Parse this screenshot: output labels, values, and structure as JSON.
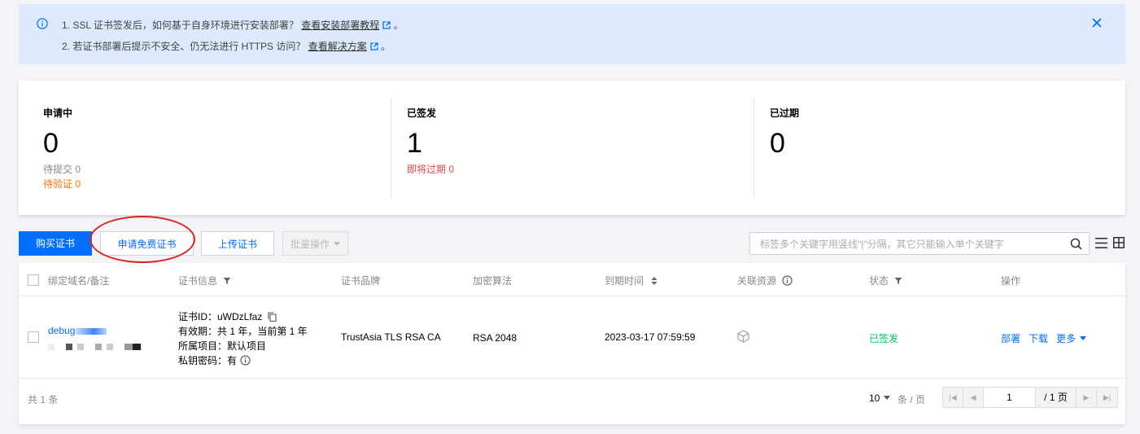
{
  "notice": {
    "line1_text": "1. SSL 证书签发后，如何基于自身环境进行安装部署？",
    "line1_link": "查看安装部署教程",
    "line1_end": "。",
    "line2_text": "2. 若证书部署后提示不安全、仍无法进行 HTTPS 访问？",
    "line2_link": "查看解决方案",
    "line2_end": "。"
  },
  "stats": [
    {
      "title": "申请中",
      "value": "0",
      "subs": [
        {
          "text": "待提交 0",
          "color": "#888888"
        },
        {
          "text": "待验证 0",
          "color": "#ff7200"
        }
      ]
    },
    {
      "title": "已签发",
      "value": "1",
      "subs": [
        {
          "text": "即将过期 0",
          "color": "#e54545"
        }
      ]
    },
    {
      "title": "已过期",
      "value": "0",
      "subs": []
    }
  ],
  "toolbar": {
    "buy_label": "购买证书",
    "apply_label": "申请免费证书",
    "upload_label": "上传证书",
    "batch_label": "批量操作",
    "search_placeholder": "标签多个关键字用竖线\"|\"分隔，其它只能输入单个关键字"
  },
  "table": {
    "headers": [
      "绑定域名/备注",
      "证书信息",
      "证书品牌",
      "加密算法",
      "到期时间",
      "关联资源",
      "状态",
      "操作"
    ],
    "rows": [
      {
        "domain": "debug",
        "cert_id": "证书ID：uWDzLfaz",
        "validity": "有效期：共 1 年，当前第 1 年",
        "project": "所属项目：默认项目",
        "private_key": "私钥密码：有",
        "brand": "TrustAsia TLS RSA CA",
        "algorithm": "RSA 2048",
        "expire": "2023-03-17 07:59:59",
        "status": "已签发",
        "ops": [
          "部署",
          "下载",
          "更多"
        ]
      }
    ],
    "footer": {
      "total": "共 1 条",
      "page_size": "10",
      "per_page": "条 / 页",
      "current_page": "1",
      "total_pages": "/ 1 页"
    }
  },
  "colors": {
    "primary": "#006eff",
    "notice_bg": "#dde9fd",
    "status_ok": "#0abf5b",
    "highlight": "#e02020"
  }
}
